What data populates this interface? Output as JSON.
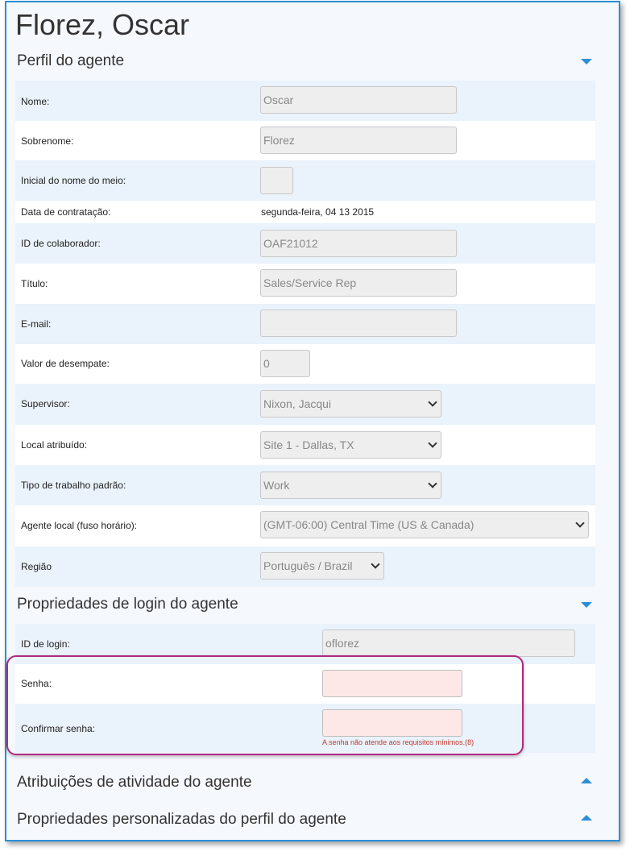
{
  "page_title": "Florez, Oscar",
  "sections": {
    "profile": "Perfil do agente",
    "login": "Propriedades de login do agente",
    "activity": "Atribuições de atividade do agente",
    "custom": "Propriedades personalizadas do perfil do agente"
  },
  "fields": {
    "first_name": {
      "label": "Nome:",
      "value": "Oscar"
    },
    "last_name": {
      "label": "Sobrenome:",
      "value": "Florez"
    },
    "middle_initial": {
      "label": "Inicial do nome do meio:",
      "value": ""
    },
    "hire_date": {
      "label": "Data de contratação:",
      "value": "segunda-feira, 04 13 2015"
    },
    "employee_id": {
      "label": "ID de colaborador:",
      "value": "OAF21012"
    },
    "title": {
      "label": "Título:",
      "value": "Sales/Service Rep"
    },
    "email": {
      "label": "E-mail:",
      "value": ""
    },
    "tiebreak": {
      "label": "Valor de desempate:",
      "value": "0"
    },
    "supervisor": {
      "label": "Supervisor:",
      "value": "Nixon, Jacqui"
    },
    "site": {
      "label": "Local atribuído:",
      "value": "Site 1 - Dallas, TX"
    },
    "work_type": {
      "label": "Tipo de trabalho padrão:",
      "value": "Work"
    },
    "timezone": {
      "label": "Agente local (fuso horário):",
      "value": "(GMT-06:00) Central Time (US & Canada)"
    },
    "region": {
      "label": "Região",
      "value": "Português / Brazil"
    }
  },
  "login": {
    "login_id": {
      "label": "ID de login:",
      "value": "oflorez"
    },
    "password": {
      "label": "Senha:",
      "value": ""
    },
    "confirm_password": {
      "label": "Confirmar senha:",
      "value": ""
    },
    "error": "A senha não atende aos requisitos mínimos.(8)"
  },
  "colors": {
    "accent": "#2c8fd6",
    "highlight": "#b0287e",
    "error": "#c0392b"
  }
}
